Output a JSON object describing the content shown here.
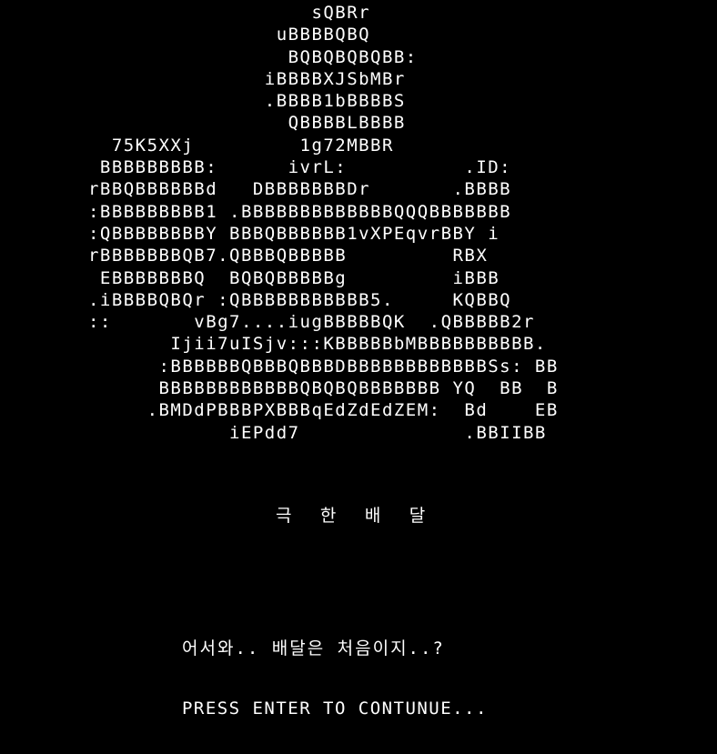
{
  "screen": {
    "background_color": "#000000",
    "text_color": "#ffffff"
  },
  "ascii_art": {
    "subject": "ascii-art-logo",
    "lines": [
      "                   sQBRr",
      "                uBBBBQBQ",
      "                 BQBQBQBQBB:",
      "               iBBBBXJSbMBr",
      "               .BBBB1bBBBBS",
      "                 QBBBBLBBBB",
      "  75K5XXj         1g72MBBR",
      " BBBBBBBBB:      ivrL:          .ID:",
      "rBBQBBBBBBd   DBBBBBBBDr       .BBBB",
      ":BBBBBBBBB1 .BBBBBBBBBBBBBQQQBBBBBBB",
      ":QBBBBBBBBY BBBQBBBBBB1vXPEqvrBBY i",
      "rBBBBBBBQB7.QBBBQBBBBB         RBX",
      " EBBBBBBBQ  BQBQBBBBBg         iBBB",
      ".iBBBBQBQr :QBBBBBBBBBBB5.     KQBBQ",
      "::       vBg7....iugBBBBBQK  .QBBBBB2r",
      "       Ijii7uISjv:::KBBBBBbMBBBBBBBBBB.",
      "      :BBBBBBQBBBQBBBDBBBBBBBBBBBBSs: BB",
      "      BBBBBBBBBBBBQBQBQBBBBBBB YQ  BB  B",
      "     .BMDdPBBBPXBBBqEdZdEdZEM:  Bd    EB",
      "            iEPdd7              .BBIIBB"
    ]
  },
  "game_title": "극 한 배 달",
  "greeting": "어서와.. 배달은 처음이지..?",
  "prompt": "PRESS ENTER TO CONTUNUE..."
}
